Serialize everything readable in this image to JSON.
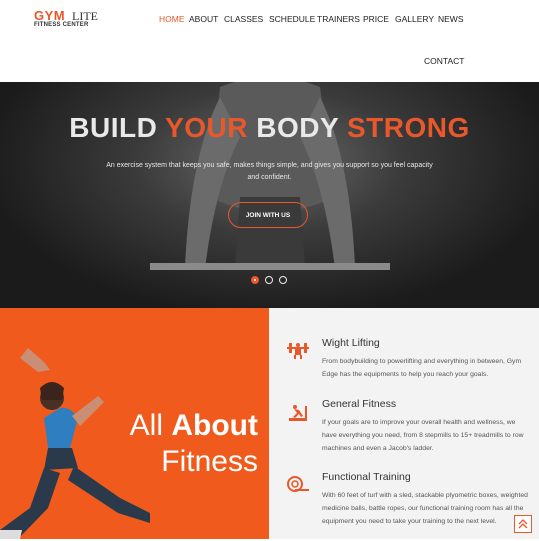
{
  "brand": {
    "logo_gym": "GYM",
    "logo_lite": "LITE",
    "logo_sub": "FITNESS CENTER"
  },
  "nav": {
    "items": [
      {
        "label": "HOME",
        "active": true
      },
      {
        "label": "ABOUT"
      },
      {
        "label": "CLASSES"
      },
      {
        "label": "SCHEDULE"
      },
      {
        "label": "TRAINERS"
      },
      {
        "label": "PRICE"
      },
      {
        "label": "GALLERY"
      },
      {
        "label": "NEWS"
      },
      {
        "label": "CONTACT"
      }
    ]
  },
  "hero": {
    "title_w1": "BUILD ",
    "title_o1": "YOUR",
    "title_w2": " BODY ",
    "title_o2": "STRONG",
    "subtitle": "An exercise system that keeps you safe, makes things simple, and gives you support so you feel capacity and confident.",
    "button": "JOIN WITH US",
    "slides_count": 3,
    "active_slide": 1
  },
  "about": {
    "title_word1": "All",
    "title_word2": "About",
    "title_word3": "Fitness"
  },
  "features": [
    {
      "title": "Wight Lifting",
      "desc": "From bodybuilding to powerlifting and everything in between, Gym Edge has the equipments to help you reach your goals.",
      "icon": "weightlifting-icon"
    },
    {
      "title": "General Fitness",
      "desc": "If your goals are to improve your overall health and wellness, we have everything you need, from 8 stepmills to 15+ treadmills to row machines and even a Jacob's ladder.",
      "icon": "treadmill-icon"
    },
    {
      "title": "Functional Training",
      "desc": "With 60 feet of turf with a sled, stackable plyometric boxes, weighted medicine balls, battle ropes, our functional training room has all the equipment you need to take your training to the next level.",
      "icon": "mat-roll-icon"
    }
  ],
  "colors": {
    "accent": "#e8582a",
    "orange_panel": "#f05a1d",
    "light_panel": "#f3f3f3"
  }
}
